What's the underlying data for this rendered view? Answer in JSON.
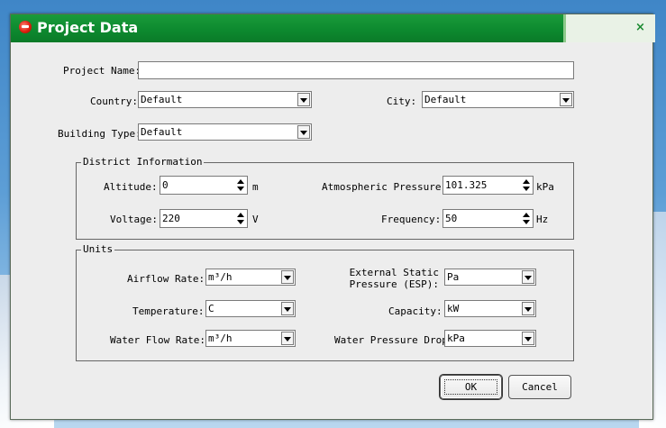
{
  "window": {
    "title": "Project Data",
    "close_label": "×"
  },
  "fields": {
    "project_name": {
      "label": "Project Name:",
      "value": ""
    },
    "country": {
      "label": "Country:",
      "value": "Default"
    },
    "city": {
      "label": "City:",
      "value": "Default"
    },
    "building_type": {
      "label": "Building Type:",
      "value": "Default"
    }
  },
  "district": {
    "title": "District Information",
    "altitude": {
      "label": "Altitude:",
      "value": "0",
      "unit": "m"
    },
    "atmospheric_pressure": {
      "label": "Atmospheric Pressure:",
      "value": "101.325",
      "unit": "kPa"
    },
    "voltage": {
      "label": "Voltage:",
      "value": "220",
      "unit": "V"
    },
    "frequency": {
      "label": "Frequency:",
      "value": "50",
      "unit": "Hz"
    }
  },
  "units": {
    "title": "Units",
    "airflow_rate": {
      "label": "Airflow Rate:",
      "value": "m³/h"
    },
    "esp": {
      "label_line1": "External Static",
      "label_line2": "Pressure (ESP):",
      "value": "Pa"
    },
    "temperature": {
      "label": "Temperature:",
      "value": "C"
    },
    "capacity": {
      "label": "Capacity:",
      "value": "kW"
    },
    "water_flow_rate": {
      "label": "Water Flow Rate:",
      "value": "m³/h"
    },
    "water_pressure_drop": {
      "label": "Water Pressure Drop",
      "value": "kPa"
    }
  },
  "buttons": {
    "ok": "OK",
    "cancel": "Cancel"
  },
  "colors": {
    "titlebar": "#0d8a2f",
    "dialog_bg": "#ededed"
  }
}
